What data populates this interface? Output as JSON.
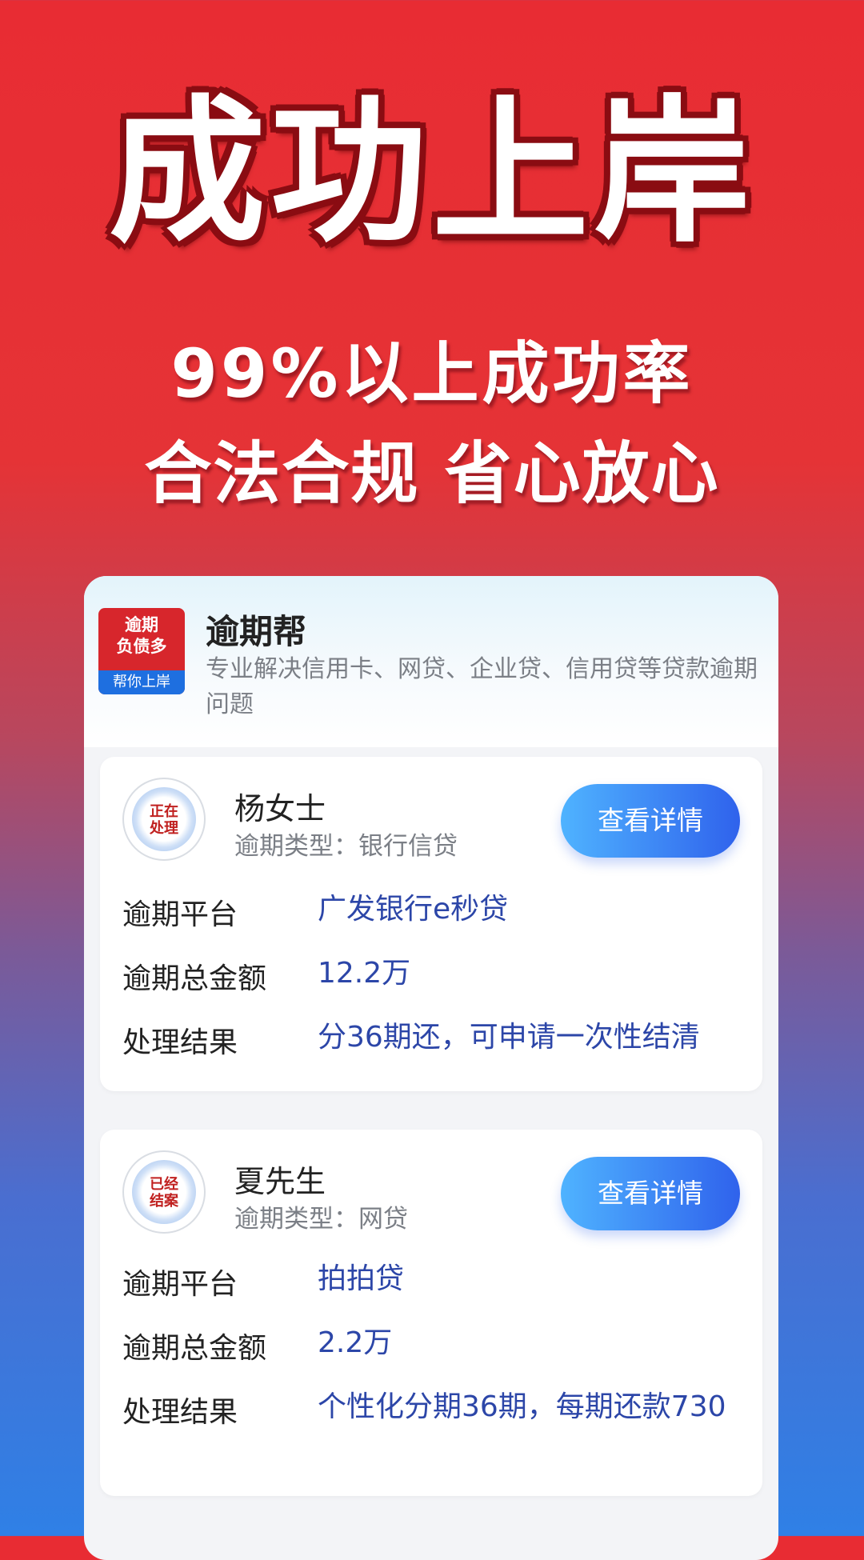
{
  "hero": {
    "title": "成功上岸",
    "line1": "99%以上成功率",
    "line2": "合法合规 省心放心"
  },
  "app": {
    "logo_top": "逾期\n负债多",
    "logo_bottom": "帮你上岸",
    "name": "逾期帮",
    "description": "专业解决信用卡、网贷、企业贷、信用贷等贷款逾期问题"
  },
  "cases": [
    {
      "seal": "正在\n处理",
      "name": "杨女士",
      "type": "逾期类型：银行信贷",
      "button": "查看详情",
      "rows": [
        {
          "label": "逾期平台",
          "value": "广发银行e秒贷"
        },
        {
          "label": "逾期总金额",
          "value": "12.2万"
        },
        {
          "label": "处理结果",
          "value": "分36期还，可申请一次性结清"
        }
      ]
    },
    {
      "seal": "已经\n结案",
      "name": "夏先生",
      "type": "逾期类型：网贷",
      "button": "查看详情",
      "rows": [
        {
          "label": "逾期平台",
          "value": "拍拍贷"
        },
        {
          "label": "逾期总金额",
          "value": "2.2万"
        },
        {
          "label": "处理结果",
          "value": "个性化分期36期，每期还款730"
        }
      ]
    }
  ],
  "colors": {
    "hero_red": "#e82c33",
    "bottom_blue": "#2f80e6",
    "value_blue": "#2c46a8",
    "button_start": "#4fb3ff",
    "button_end": "#2f62ec",
    "logo_red": "#d7262c",
    "logo_blue": "#1e6fe0"
  }
}
